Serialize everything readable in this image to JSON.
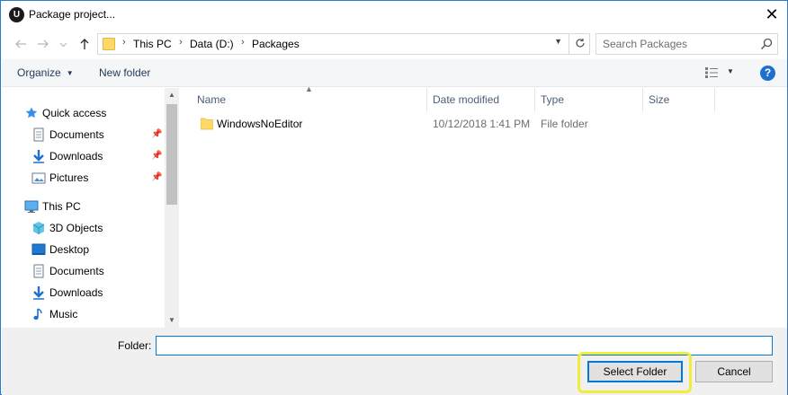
{
  "window": {
    "title": "Package project...",
    "app_icon": "unreal-engine-icon",
    "close_glyph": "✕"
  },
  "nav": {
    "back_icon": "arrow-left-icon",
    "forward_icon": "arrow-right-icon",
    "recent_icon": "chevron-down-icon",
    "up_icon": "arrow-up-icon",
    "breadcrumb": [
      "This PC",
      "Data (D:)",
      "Packages"
    ],
    "search_placeholder": "Search Packages"
  },
  "commands": {
    "organize": "Organize",
    "new_folder": "New folder",
    "help": "?"
  },
  "sidebar": {
    "items": [
      {
        "label": "Quick access",
        "icon": "star-icon",
        "pinned": false
      },
      {
        "label": "Documents",
        "icon": "documents-icon",
        "pinned": true
      },
      {
        "label": "Downloads",
        "icon": "download-arrow-icon",
        "pinned": true
      },
      {
        "label": "Pictures",
        "icon": "pictures-icon",
        "pinned": true
      },
      {
        "label": "This PC",
        "icon": "monitor-icon",
        "pinned": false
      },
      {
        "label": "3D Objects",
        "icon": "cube-icon",
        "pinned": false
      },
      {
        "label": "Desktop",
        "icon": "desktop-icon",
        "pinned": false
      },
      {
        "label": "Documents",
        "icon": "documents-icon",
        "pinned": false
      },
      {
        "label": "Downloads",
        "icon": "download-arrow-icon",
        "pinned": false
      },
      {
        "label": "Music",
        "icon": "music-note-icon",
        "pinned": false
      }
    ]
  },
  "filelist": {
    "columns": [
      "Name",
      "Date modified",
      "Type",
      "Size"
    ],
    "rows": [
      {
        "name": "WindowsNoEditor",
        "date": "10/12/2018 1:41 PM",
        "type": "File folder",
        "size": ""
      }
    ]
  },
  "footer": {
    "folder_label": "Folder:",
    "folder_value": "",
    "select_button": "Select Folder",
    "cancel_button": "Cancel"
  },
  "colors": {
    "accent": "#0078d7",
    "highlight": "#f3ec3a",
    "folder": "#ffd866"
  }
}
